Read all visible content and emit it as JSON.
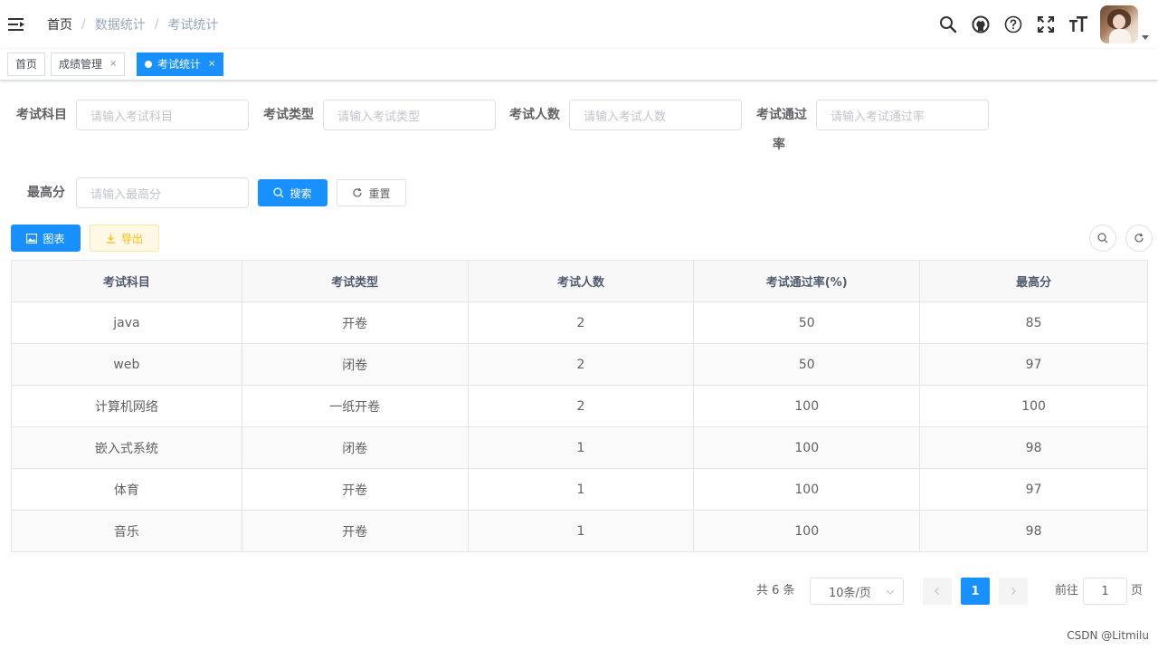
{
  "navbar": {
    "breadcrumb": [
      "首页",
      "数据统计",
      "考试统计"
    ],
    "separator": "/",
    "icons": [
      "search-icon",
      "github-icon",
      "question-circle-icon",
      "fullscreen-icon",
      "font-size-icon"
    ]
  },
  "tags": [
    {
      "label": "首页",
      "closable": false,
      "active": false
    },
    {
      "label": "成绩管理",
      "closable": true,
      "active": false
    },
    {
      "label": "考试统计",
      "closable": true,
      "active": true
    }
  ],
  "tag_close_glyph": "×",
  "search_form": {
    "subject": {
      "label": "考试科目",
      "placeholder": "请输入考试科目"
    },
    "type": {
      "label": "考试类型",
      "placeholder": "请输入考试类型"
    },
    "count": {
      "label": "考试人数",
      "placeholder": "请输入考试人数"
    },
    "pass_rate": {
      "label_line1": "考试通过",
      "label_line2": "率",
      "placeholder": "请输入考试通过率"
    },
    "max_score": {
      "label": "最高分",
      "placeholder": "请输入最高分"
    },
    "search_button": "搜索",
    "reset_button": "重置"
  },
  "toolbar": {
    "chart_button": "图表",
    "export_button": "导出"
  },
  "table": {
    "columns": [
      "考试科目",
      "考试类型",
      "考试人数",
      "考试通过率(%)",
      "最高分"
    ],
    "rows": [
      [
        "java",
        "开卷",
        "2",
        "50",
        "85"
      ],
      [
        "web",
        "闭卷",
        "2",
        "50",
        "97"
      ],
      [
        "计算机网络",
        "一纸开卷",
        "2",
        "100",
        "100"
      ],
      [
        "嵌入式系统",
        "闭卷",
        "1",
        "100",
        "98"
      ],
      [
        "体育",
        "开卷",
        "1",
        "100",
        "97"
      ],
      [
        "音乐",
        "开卷",
        "1",
        "100",
        "98"
      ]
    ]
  },
  "pagination": {
    "total_text": "共 6 条",
    "page_size": "10条/页",
    "current_page": "1",
    "jump_prefix": "前往",
    "jump_value": "1",
    "jump_suffix": "页"
  },
  "watermark": "CSDN @Litmilu",
  "colors": {
    "primary": "#1890ff",
    "warning": "#ffba00"
  }
}
